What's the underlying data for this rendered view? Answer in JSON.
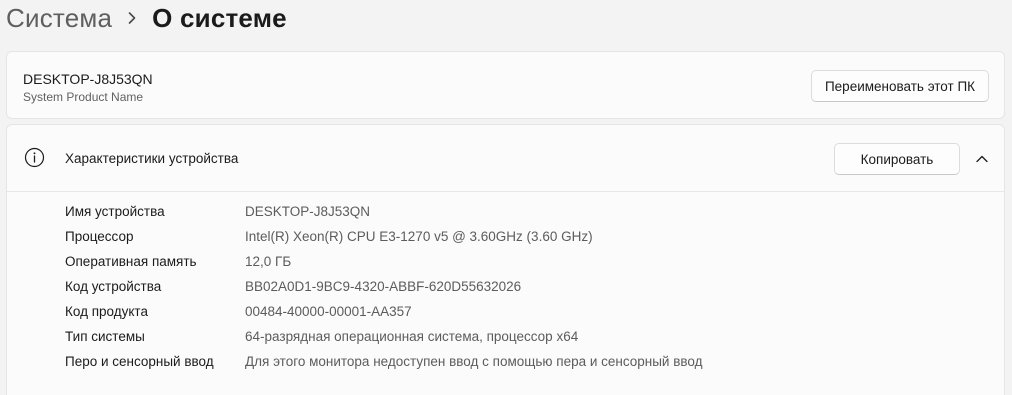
{
  "breadcrumb": {
    "parent": "Система",
    "current": "О системе"
  },
  "device": {
    "name": "DESKTOP-J8J53QN",
    "model": "System Product Name",
    "rename_label": "Переименовать этот ПК"
  },
  "specs": {
    "title": "Характеристики устройства",
    "copy_label": "Копировать",
    "rows": [
      {
        "label": "Имя устройства",
        "value": "DESKTOP-J8J53QN"
      },
      {
        "label": "Процессор",
        "value": "Intel(R) Xeon(R) CPU E3-1270 v5 @ 3.60GHz (3.60 GHz)"
      },
      {
        "label": "Оперативная память",
        "value": "12,0 ГБ"
      },
      {
        "label": "Код устройства",
        "value": "BB02A0D1-9BC9-4320-ABBF-620D55632026"
      },
      {
        "label": "Код продукта",
        "value": "00484-40000-00001-AA357"
      },
      {
        "label": "Тип системы",
        "value": "64-разрядная операционная система, процессор x64"
      },
      {
        "label": "Перо и сенсорный ввод",
        "value": "Для этого монитора недоступен ввод с помощью пера и сенсорный ввод"
      }
    ]
  },
  "icons": {
    "breadcrumb_separator": "chevron-right-icon",
    "specs": "info-icon",
    "collapse": "chevron-up-icon"
  }
}
